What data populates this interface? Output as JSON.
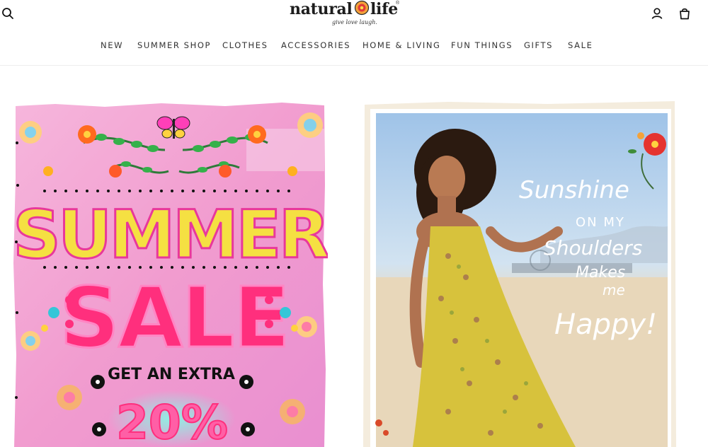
{
  "brand": {
    "name_left": "natural",
    "name_right": "life",
    "tagline": "give love laugh.",
    "registered": "®"
  },
  "header_icons": {
    "search": "search-icon",
    "account": "account-icon",
    "cart": "cart-icon"
  },
  "nav": {
    "items": [
      {
        "label": "NEW"
      },
      {
        "label": "SUMMER SHOP"
      },
      {
        "label": "CLOTHES"
      },
      {
        "label": "ACCESSORIES"
      },
      {
        "label": "HOME & LIVING"
      },
      {
        "label": "FUN THINGS"
      },
      {
        "label": "GIFTS"
      },
      {
        "label": "SALE"
      }
    ]
  },
  "promo_left": {
    "line1": "SUMMER",
    "line2": "SALE",
    "extra": "GET AN EXTRA",
    "percent": "20%"
  },
  "promo_right": {
    "script_line1": "Sunshine",
    "script_line2": "ON MY",
    "script_line3": "Shoulders",
    "script_line4": "Makes",
    "script_line5": "me",
    "script_line6": "Happy!"
  },
  "colors": {
    "pink_bg": "#f1a8d4",
    "summer_yellow": "#f5e042",
    "sale_pink": "#ff2f7d",
    "sky": "#c9ddf0",
    "sand": "#e6d7bd",
    "dress": "#d7c23c"
  }
}
